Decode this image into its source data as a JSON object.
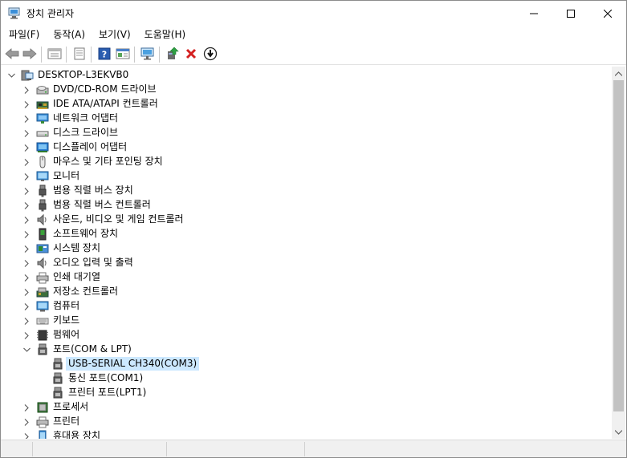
{
  "window": {
    "title": "장치 관리자"
  },
  "menu": [
    "파일(F)",
    "동작(A)",
    "보기(V)",
    "도움말(H)"
  ],
  "toolbar": {
    "buttons": [
      "back-icon",
      "forward-icon",
      "properties-view-icon",
      "show-hidden-icon",
      "help-icon",
      "details-icon",
      "monitor-scan-icon",
      "update-driver-icon",
      "uninstall-icon",
      "disable-icon"
    ]
  },
  "tree": {
    "root": "DESKTOP-L3EKVB0",
    "categories": [
      {
        "label": "DVD/CD-ROM 드라이브",
        "icon": "dvd-drive-icon"
      },
      {
        "label": "IDE ATA/ATAPI 컨트롤러",
        "icon": "ide-controller-icon"
      },
      {
        "label": "네트워크 어댑터",
        "icon": "network-adapter-icon"
      },
      {
        "label": "디스크 드라이브",
        "icon": "disk-drive-icon"
      },
      {
        "label": "디스플레이 어댑터",
        "icon": "display-adapter-icon"
      },
      {
        "label": "마우스 및 기타 포인팅 장치",
        "icon": "mouse-icon"
      },
      {
        "label": "모니터",
        "icon": "monitor-icon"
      },
      {
        "label": "범용 직렬 버스 장치",
        "icon": "usb-device-icon"
      },
      {
        "label": "범용 직렬 버스 컨트롤러",
        "icon": "usb-controller-icon"
      },
      {
        "label": "사운드, 비디오 및 게임 컨트롤러",
        "icon": "sound-icon"
      },
      {
        "label": "소프트웨어 장치",
        "icon": "software-device-icon"
      },
      {
        "label": "시스템 장치",
        "icon": "system-device-icon"
      },
      {
        "label": "오디오 입력 및 출력",
        "icon": "audio-io-icon"
      },
      {
        "label": "인쇄 대기열",
        "icon": "print-queue-icon"
      },
      {
        "label": "저장소 컨트롤러",
        "icon": "storage-controller-icon"
      },
      {
        "label": "컴퓨터",
        "icon": "computer-icon"
      },
      {
        "label": "키보드",
        "icon": "keyboard-icon"
      },
      {
        "label": "펌웨어",
        "icon": "firmware-icon"
      },
      {
        "label": "포트(COM & LPT)",
        "icon": "port-icon",
        "expanded": true,
        "children": [
          "USB-SERIAL CH340(COM3)",
          "통신 포트(COM1)",
          "프린터 포트(LPT1)"
        ]
      },
      {
        "label": "프로세서",
        "icon": "processor-icon"
      },
      {
        "label": "프린터",
        "icon": "printer-icon"
      },
      {
        "label": "휴대용 장치",
        "icon": "portable-device-icon"
      }
    ],
    "selected": "USB-SERIAL CH340(COM3)"
  }
}
